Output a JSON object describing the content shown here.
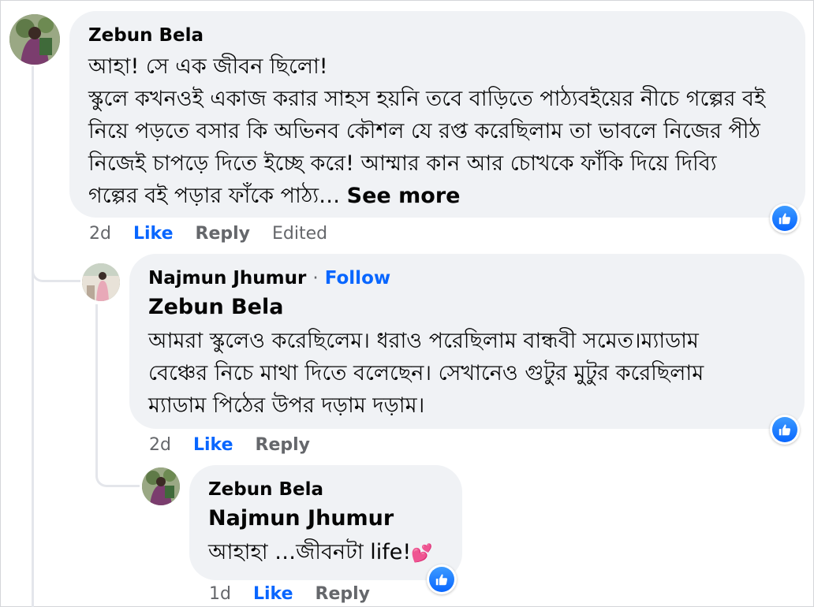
{
  "comments": [
    {
      "author": "Zebun Bela",
      "mention": "",
      "lines": [
        "আহা! সে এক জীবন ছিলো!",
        "স্কুলে কখনওই একাজ করার সাহস হয়নি তবে বাড়িতে পাঠ্যবইয়ের নীচে গল্পের বই",
        "নিয়ে পড়তে বসার কি অভিনব কৌশল যে রপ্ত করেছিলাম তা ভাবলে নিজের পীঠ",
        "নিজেই চাপড়ে দিতে ইচ্ছে করে! আম্মার কান আর চোখকে ফাঁকি দিয়ে দিব্যি",
        "গল্পের বই পড়ার ফাঁকে পাঠ্য…"
      ],
      "see_more": "See more",
      "time": "2d",
      "like": "Like",
      "reply": "Reply",
      "edited": "Edited"
    },
    {
      "author": "Najmun Jhumur",
      "follow_sep": "·",
      "follow": "Follow",
      "mention": "Zebun Bela",
      "lines": [
        "আমরা স্কুলেও করেছিলেম। ধরাও পরেছিলাম বান্ধবী সমেত।ম্যাডাম",
        "বেঞ্চের নিচে মাথা দিতে বলেছেন। সেখানেও গুটুর মুটুর করেছিলাম",
        "ম্যাডাম পিঠের উপর দড়াম দড়াম।"
      ],
      "time": "2d",
      "like": "Like",
      "reply": "Reply"
    },
    {
      "author": "Zebun Bela",
      "mention": "Najmun Jhumur",
      "text": "আহাহা …জীবনটা life!",
      "emoji": "💕",
      "time": "1d",
      "like": "Like",
      "reply": "Reply"
    }
  ],
  "icons": {
    "reaction": "like-reaction-icon",
    "avatar_main": "avatar",
    "avatar_reply": "avatar"
  },
  "colors": {
    "bubble": "#f0f2f5",
    "link": "#0866ff",
    "meta": "#65676b",
    "text": "#050505"
  }
}
